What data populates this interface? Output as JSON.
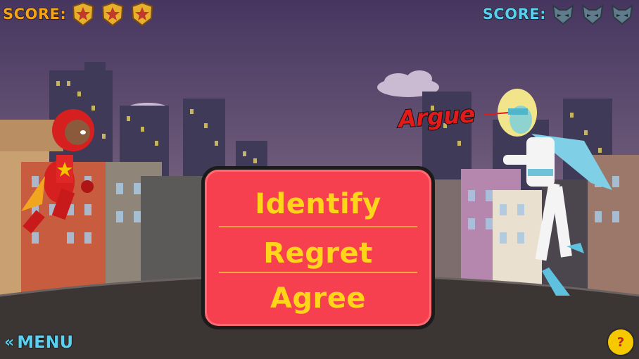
{
  "hud": {
    "left_score_label": "SCORE:",
    "right_score_label": "SCORE:",
    "left_badges": [
      "star-badge",
      "star-badge",
      "star-badge"
    ],
    "right_badges": [
      "fox-badge",
      "fox-badge",
      "fox-badge"
    ]
  },
  "enemy_word": "Argue",
  "choices": [
    "Identify",
    "Regret",
    "Agree"
  ],
  "menu": {
    "arrow": "«",
    "label": "MENU"
  },
  "help": {
    "label": "?"
  },
  "colors": {
    "panel": "#f6404f",
    "choice_text": "#ffd51a",
    "left_score": "#f7a31a",
    "right_score": "#5ad0f0",
    "enemy_word": "#e21a1a",
    "help_button": "#f6c800"
  }
}
